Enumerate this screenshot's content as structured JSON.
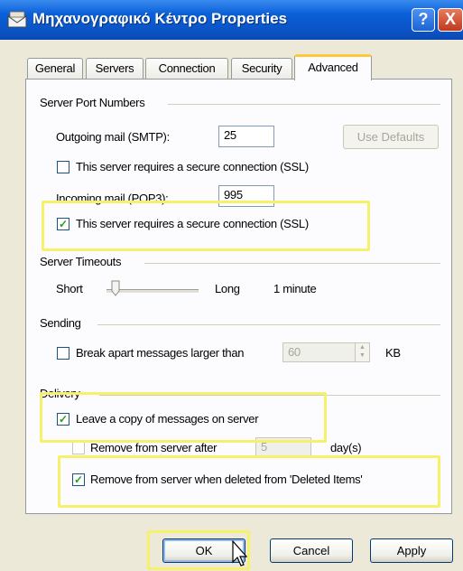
{
  "window": {
    "title": "Μηχανογραφικό Κέντρο Properties",
    "help_glyph": "?",
    "close_glyph": "X"
  },
  "tabs": [
    {
      "label": "General"
    },
    {
      "label": "Servers"
    },
    {
      "label": "Connection"
    },
    {
      "label": "Security"
    },
    {
      "label": "Advanced"
    }
  ],
  "active_tab": "Advanced",
  "server_ports": {
    "heading": "Server Port Numbers",
    "outgoing_label": "Outgoing mail (SMTP):",
    "outgoing_value": "25",
    "use_defaults_label": "Use Defaults",
    "outgoing_ssl_label": "This server requires a secure connection (SSL)",
    "outgoing_ssl_checked": false,
    "incoming_label": "Incoming mail (POP3):",
    "incoming_value": "995",
    "incoming_ssl_label": "This server requires a secure connection (SSL)",
    "incoming_ssl_checked": true
  },
  "timeouts": {
    "heading": "Server Timeouts",
    "short_label": "Short",
    "long_label": "Long",
    "value_label": "1 minute"
  },
  "sending": {
    "heading": "Sending",
    "break_apart_label": "Break apart messages larger than",
    "break_apart_checked": false,
    "size_value": "60",
    "unit_label": "KB"
  },
  "delivery": {
    "heading": "Delivery",
    "leave_copy_label": "Leave a copy of messages on server",
    "leave_copy_checked": true,
    "remove_after_label": "Remove from server after",
    "remove_after_checked": false,
    "days_value": "5",
    "days_unit": "day(s)",
    "remove_deleted_label": "Remove from server when deleted from 'Deleted Items'",
    "remove_deleted_checked": true
  },
  "buttons": {
    "ok": "OK",
    "cancel": "Cancel",
    "apply": "Apply"
  },
  "colors": {
    "highlight": "#f6f06a",
    "titlebar": "#0b53c4",
    "dialog_bg": "#ece9d8"
  }
}
